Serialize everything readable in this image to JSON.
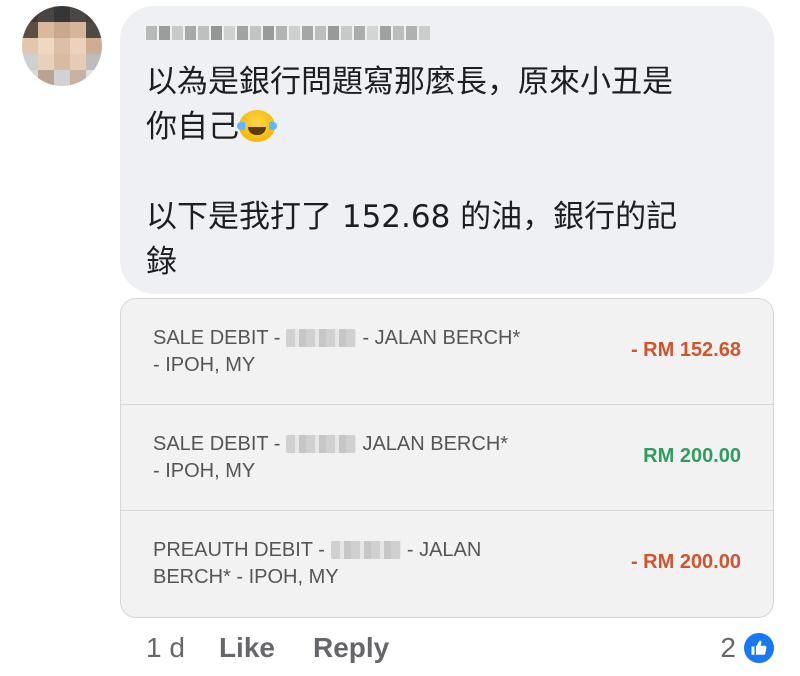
{
  "comment": {
    "line1": "以為是銀行問題寫那麼長，原來小丑是",
    "line2": "你自己",
    "emoji": "face-with-tears-of-joy",
    "line3": "以下是我打了 152.68 的油，銀行的記",
    "line4": "錄"
  },
  "transactions": [
    {
      "desc_a": "SALE DEBIT -",
      "desc_b": "- JALAN BERCH*",
      "desc_c": "- IPOH, MY",
      "amount": "- RM 152.68",
      "color": "#d1542a"
    },
    {
      "desc_a": "SALE DEBIT -",
      "desc_b": "JALAN BERCH*",
      "desc_c": "- IPOH, MY",
      "amount": "RM 200.00",
      "color": "#2e9e5f"
    },
    {
      "desc_a": "PREAUTH DEBIT -",
      "desc_b": "- JALAN",
      "desc_c": "BERCH* - IPOH, MY",
      "amount": "- RM 200.00",
      "color": "#d1542a"
    }
  ],
  "footer": {
    "time": "1 d",
    "like": "Like",
    "reply": "Reply",
    "reaction_count": "2",
    "reaction_icon": "thumbs-up-icon"
  },
  "colors": {
    "bubble_bg": "#eef0f3",
    "like_blue": "#1877f2",
    "debit": "#d1542a",
    "credit": "#2e9e5f"
  }
}
